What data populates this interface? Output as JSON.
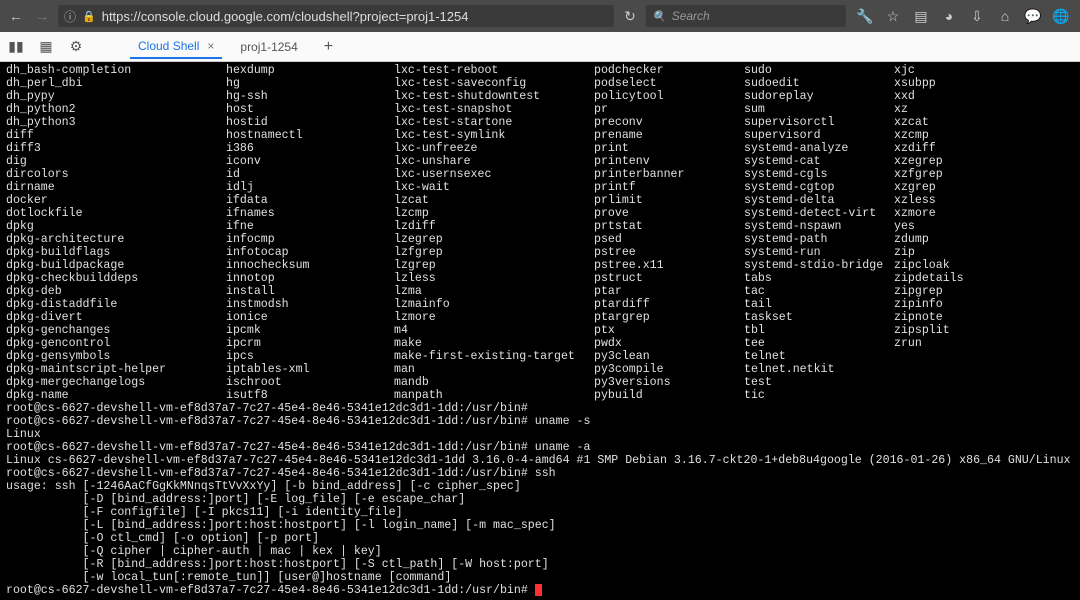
{
  "browser": {
    "url": "https://console.cloud.google.com/cloudshell?project=proj1-1254",
    "search_placeholder": "Search"
  },
  "tabs": [
    {
      "label": "Cloud Shell",
      "active": true
    },
    {
      "label": "proj1-1254",
      "active": false
    }
  ],
  "cmd_columns": [
    [
      "dh_bash-completion",
      "dh_perl_dbi",
      "dh_pypy",
      "dh_python2",
      "dh_python3",
      "diff",
      "diff3",
      "dig",
      "dircolors",
      "dirname",
      "docker",
      "dotlockfile",
      "dpkg",
      "dpkg-architecture",
      "dpkg-buildflags",
      "dpkg-buildpackage",
      "dpkg-checkbuilddeps",
      "dpkg-deb",
      "dpkg-distaddfile",
      "dpkg-divert",
      "dpkg-genchanges",
      "dpkg-gencontrol",
      "dpkg-gensymbols",
      "dpkg-maintscript-helper",
      "dpkg-mergechangelogs",
      "dpkg-name"
    ],
    [
      "hexdump",
      "hg",
      "hg-ssh",
      "host",
      "hostid",
      "hostnamectl",
      "i386",
      "iconv",
      "id",
      "idlj",
      "ifdata",
      "ifnames",
      "ifne",
      "infocmp",
      "infotocap",
      "innochecksum",
      "innotop",
      "install",
      "instmodsh",
      "ionice",
      "ipcmk",
      "ipcrm",
      "ipcs",
      "iptables-xml",
      "ischroot",
      "isutf8"
    ],
    [
      "lxc-test-reboot",
      "lxc-test-saveconfig",
      "lxc-test-shutdowntest",
      "lxc-test-snapshot",
      "lxc-test-startone",
      "lxc-test-symlink",
      "lxc-unfreeze",
      "lxc-unshare",
      "lxc-usernsexec",
      "lxc-wait",
      "lzcat",
      "lzcmp",
      "lzdiff",
      "lzegrep",
      "lzfgrep",
      "lzgrep",
      "lzless",
      "lzma",
      "lzmainfo",
      "lzmore",
      "m4",
      "make",
      "make-first-existing-target",
      "man",
      "mandb",
      "manpath"
    ],
    [
      "podchecker",
      "podselect",
      "policytool",
      "pr",
      "preconv",
      "prename",
      "print",
      "printenv",
      "printerbanner",
      "printf",
      "prlimit",
      "prove",
      "prtstat",
      "psed",
      "pstree",
      "pstree.x11",
      "pstruct",
      "ptar",
      "ptardiff",
      "ptargrep",
      "ptx",
      "pwdx",
      "py3clean",
      "py3compile",
      "py3versions",
      "pybuild"
    ],
    [
      "sudo",
      "sudoedit",
      "sudoreplay",
      "sum",
      "supervisorctl",
      "supervisord",
      "systemd-analyze",
      "systemd-cat",
      "systemd-cgls",
      "systemd-cgtop",
      "systemd-delta",
      "systemd-detect-virt",
      "systemd-nspawn",
      "systemd-path",
      "systemd-run",
      "systemd-stdio-bridge",
      "tabs",
      "tac",
      "tail",
      "taskset",
      "tbl",
      "tee",
      "telnet",
      "telnet.netkit",
      "test",
      "tic"
    ],
    [
      "xjc",
      "xsubpp",
      "xxd",
      "xz",
      "xzcat",
      "xzcmp",
      "xzdiff",
      "xzegrep",
      "xzfgrep",
      "xzgrep",
      "xzless",
      "xzmore",
      "yes",
      "zdump",
      "zip",
      "zipcloak",
      "zipdetails",
      "zipgrep",
      "zipinfo",
      "zipnote",
      "zipsplit",
      "zrun",
      "",
      "",
      "",
      ""
    ]
  ],
  "terminal_lines": [
    "root@cs-6627-devshell-vm-ef8d37a7-7c27-45e4-8e46-5341e12dc3d1-1dd:/usr/bin#",
    "root@cs-6627-devshell-vm-ef8d37a7-7c27-45e4-8e46-5341e12dc3d1-1dd:/usr/bin# uname -s",
    "Linux",
    "root@cs-6627-devshell-vm-ef8d37a7-7c27-45e4-8e46-5341e12dc3d1-1dd:/usr/bin# uname -a",
    "Linux cs-6627-devshell-vm-ef8d37a7-7c27-45e4-8e46-5341e12dc3d1-1dd 3.16.0-4-amd64 #1 SMP Debian 3.16.7-ckt20-1+deb8u4google (2016-01-26) x86_64 GNU/Linux",
    "root@cs-6627-devshell-vm-ef8d37a7-7c27-45e4-8e46-5341e12dc3d1-1dd:/usr/bin# ssh",
    "usage: ssh [-1246AaCfGgKkMNnqsTtVvXxYy] [-b bind_address] [-c cipher_spec]",
    "           [-D [bind_address:]port] [-E log_file] [-e escape_char]",
    "           [-F configfile] [-I pkcs11] [-i identity_file]",
    "           [-L [bind_address:]port:host:hostport] [-l login_name] [-m mac_spec]",
    "           [-O ctl_cmd] [-o option] [-p port]",
    "           [-Q cipher | cipher-auth | mac | kex | key]",
    "           [-R [bind_address:]port:host:hostport] [-S ctl_path] [-W host:port]",
    "           [-w local_tun[:remote_tun]] [user@]hostname [command]"
  ],
  "prompt_line": "root@cs-6627-devshell-vm-ef8d37a7-7c27-45e4-8e46-5341e12dc3d1-1dd:/usr/bin# "
}
